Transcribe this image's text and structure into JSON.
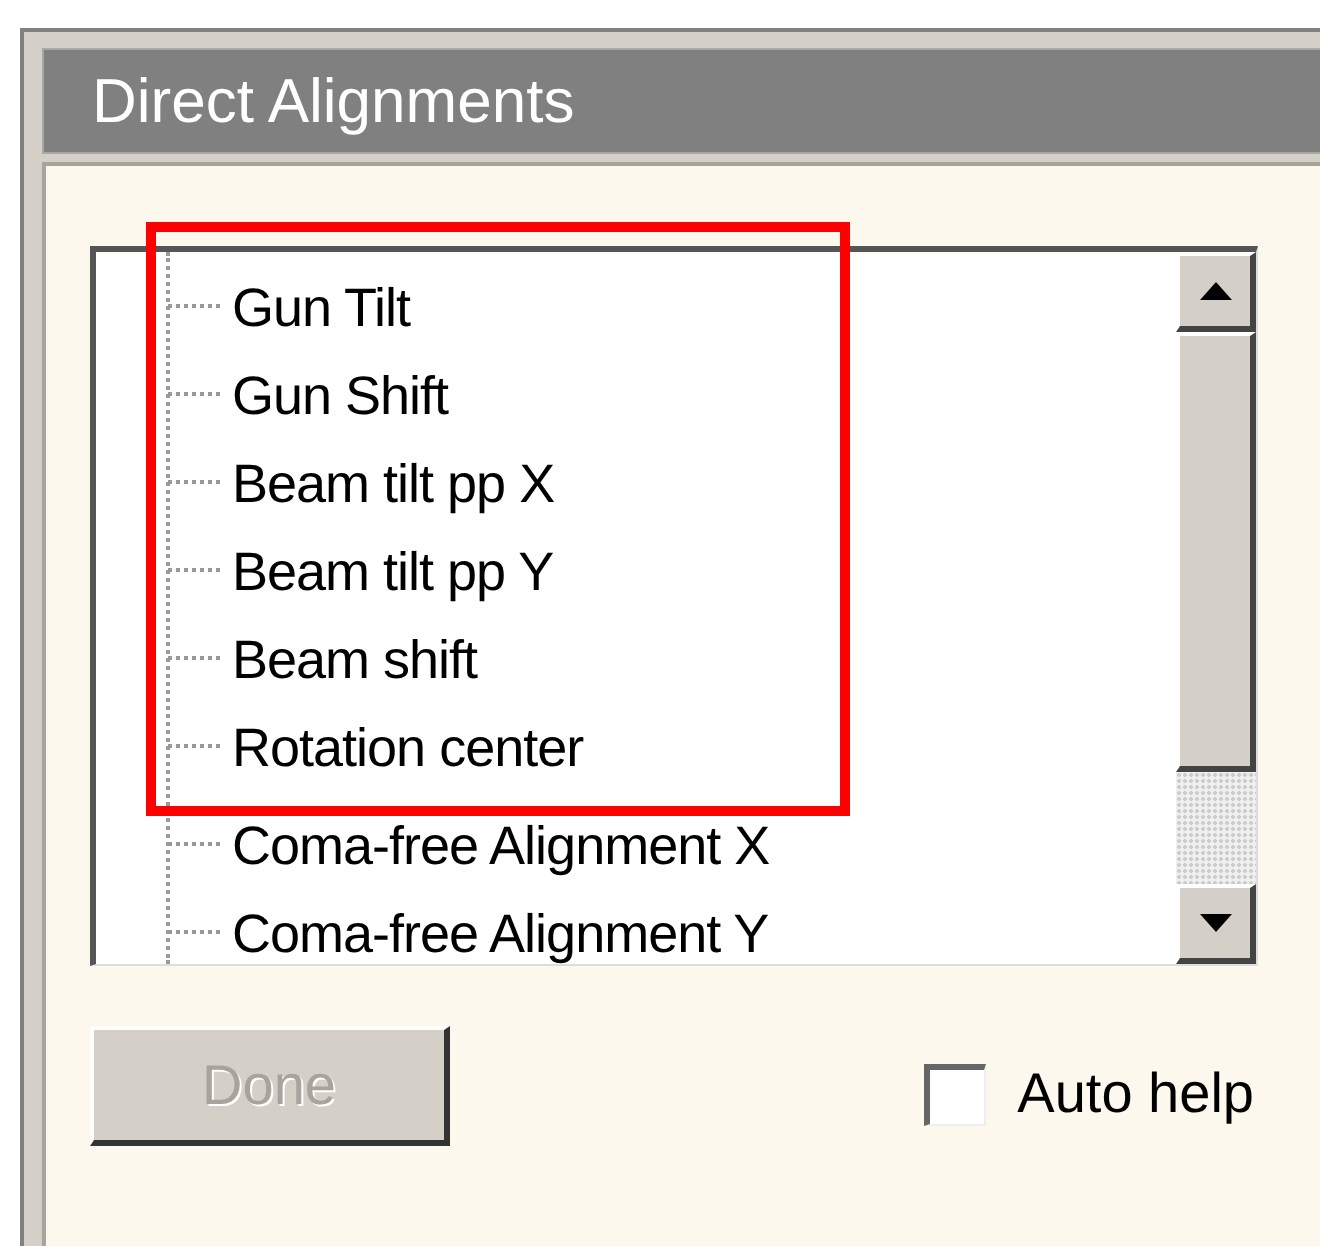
{
  "dialog": {
    "title": "Direct Alignments"
  },
  "alignments": [
    {
      "label": "Gun Tilt",
      "highlighted": true
    },
    {
      "label": "Gun Shift",
      "highlighted": true
    },
    {
      "label": "Beam tilt pp X",
      "highlighted": true
    },
    {
      "label": "Beam tilt pp Y",
      "highlighted": true
    },
    {
      "label": "Beam shift",
      "highlighted": true
    },
    {
      "label": "Rotation center",
      "highlighted": true
    },
    {
      "label": "Coma-free Alignment X",
      "highlighted": false
    },
    {
      "label": "Coma-free Alignment Y",
      "highlighted": false
    }
  ],
  "done_button": {
    "label": "Done",
    "disabled": true
  },
  "auto_help": {
    "label": "Auto help",
    "checked": false
  }
}
